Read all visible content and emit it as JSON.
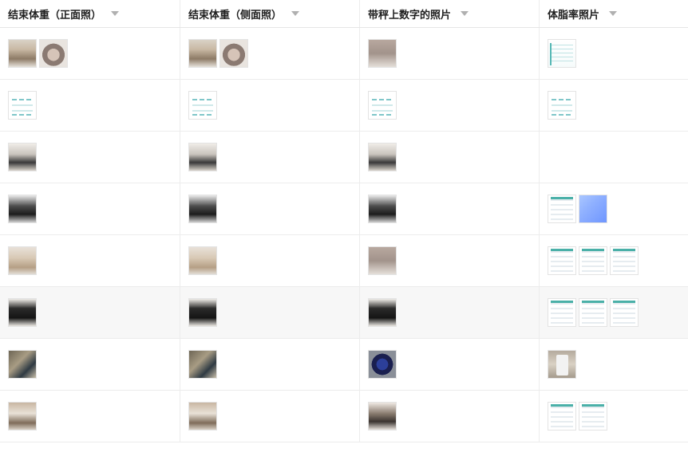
{
  "columns": [
    {
      "label": "结束体重（正面照）",
      "sort_icon": "chevron-down-icon"
    },
    {
      "label": "结束体重（侧面照）",
      "sort_icon": "chevron-down-icon"
    },
    {
      "label": "带秤上数字的照片",
      "sort_icon": "chevron-down-icon"
    },
    {
      "label": "体脂率照片",
      "sort_icon": "chevron-down-icon"
    }
  ],
  "rows": [
    {
      "c0": [
        "photo-body",
        "photo-scale"
      ],
      "c1": [
        "photo-body",
        "photo-scale"
      ],
      "c2": [
        "photo-feet"
      ],
      "c3": [
        "chart"
      ]
    },
    {
      "c0": [
        "doc"
      ],
      "c1": [
        "doc"
      ],
      "c2": [
        "doc"
      ],
      "c3": [
        "doc"
      ]
    },
    {
      "c0": [
        "photo-room"
      ],
      "c1": [
        "photo-room"
      ],
      "c2": [
        "photo-room"
      ],
      "c3": []
    },
    {
      "c0": [
        "photo-dark"
      ],
      "c1": [
        "photo-dark"
      ],
      "c2": [
        "photo-dark"
      ],
      "c3": [
        "screen-list",
        "screen-blue"
      ]
    },
    {
      "c0": [
        "photo-beige"
      ],
      "c1": [
        "photo-beige"
      ],
      "c2": [
        "photo-feet"
      ],
      "c3": [
        "screen-list",
        "screen-list",
        "screen-list"
      ]
    },
    {
      "c0": [
        "photo-black"
      ],
      "c1": [
        "photo-black"
      ],
      "c2": [
        "photo-black"
      ],
      "c3": [
        "screen-list",
        "screen-list",
        "screen-list"
      ]
    },
    {
      "c0": [
        "photo-hold"
      ],
      "c1": [
        "photo-hold"
      ],
      "c2": [
        "photo-blue"
      ],
      "c3": [
        "phone"
      ]
    },
    {
      "c0": [
        "photo-mix"
      ],
      "c1": [
        "photo-mix"
      ],
      "c2": [
        "photo-feet2"
      ],
      "c3": [
        "screen-list",
        "screen-list"
      ]
    }
  ]
}
